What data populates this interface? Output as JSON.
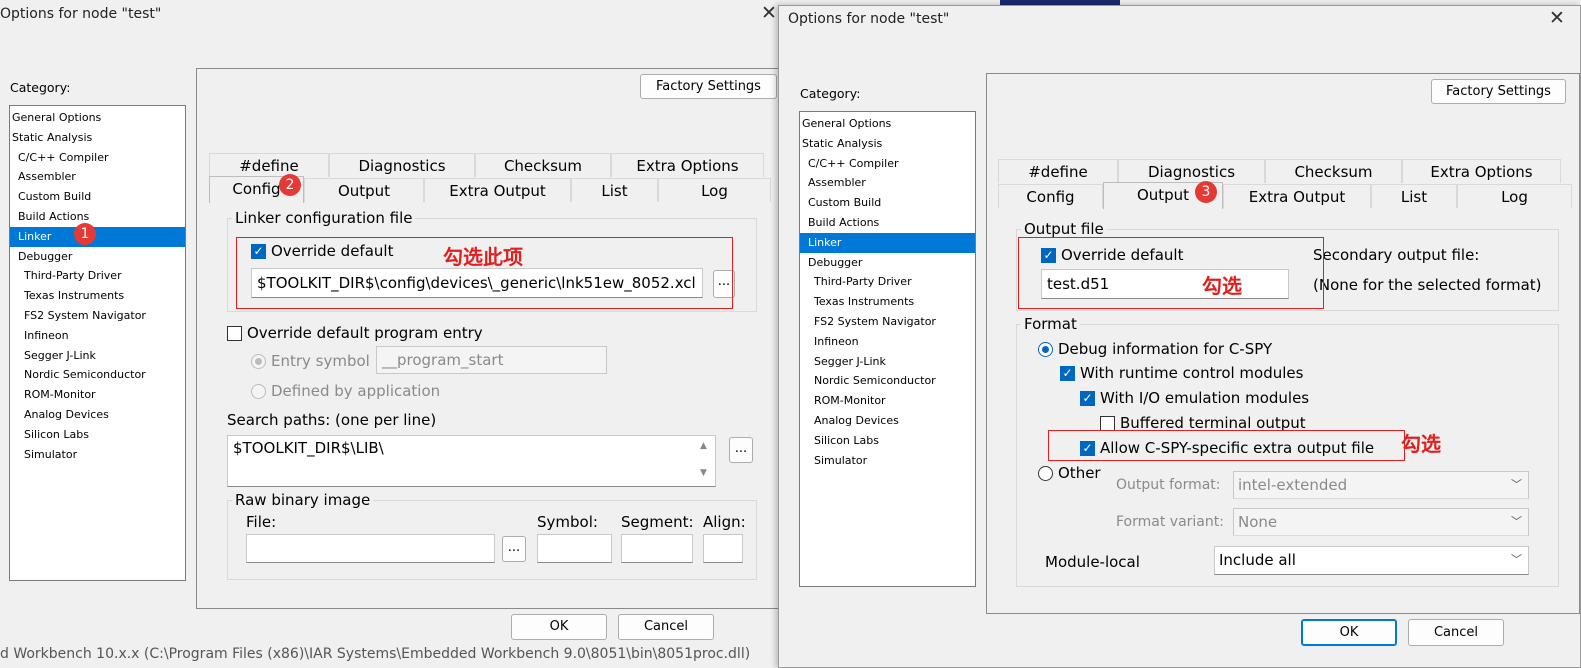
{
  "left": {
    "title": "Options for node \"test\"",
    "category_label": "Category:",
    "categories": [
      {
        "label": "General Options",
        "level": 0
      },
      {
        "label": "Static Analysis",
        "level": 0
      },
      {
        "label": "C/C++ Compiler",
        "level": 1
      },
      {
        "label": "Assembler",
        "level": 1
      },
      {
        "label": "Custom Build",
        "level": 1
      },
      {
        "label": "Build Actions",
        "level": 1
      },
      {
        "label": "Linker",
        "level": 1,
        "selected": true
      },
      {
        "label": "Debugger",
        "level": 1
      },
      {
        "label": "Third-Party Driver",
        "level": 2
      },
      {
        "label": "Texas Instruments",
        "level": 2
      },
      {
        "label": "FS2 System Navigator",
        "level": 2
      },
      {
        "label": "Infineon",
        "level": 2
      },
      {
        "label": "Segger J-Link",
        "level": 2
      },
      {
        "label": "Nordic Semiconductor",
        "level": 2
      },
      {
        "label": "ROM-Monitor",
        "level": 2
      },
      {
        "label": "Analog Devices",
        "level": 2
      },
      {
        "label": "Silicon Labs",
        "level": 2
      },
      {
        "label": "Simulator",
        "level": 2
      }
    ],
    "factory_settings": "Factory Settings",
    "tabs_row1": [
      "#define",
      "Diagnostics",
      "Checksum",
      "Extra Options"
    ],
    "tabs_row2": [
      "Config",
      "Output",
      "Extra Output",
      "List",
      "Log"
    ],
    "linker_group_title": "Linker configuration file",
    "override_default": "Override default",
    "config_path": "$TOOLKIT_DIR$\\config\\devices\\_generic\\lnk51ew_8052.xcl",
    "browse": "...",
    "override_entry": "Override default program entry",
    "entry_symbol": "Entry symbol",
    "entry_symbol_value": "__program_start",
    "defined_by_app": "Defined by application",
    "search_paths_label": "Search paths:  (one per line)",
    "search_paths_value": "$TOOLKIT_DIR$\\LIB\\",
    "raw_binary_title": "Raw binary image",
    "file_label": "File:",
    "symbol_label": "Symbol:",
    "segment_label": "Segment:",
    "align_label": "Align:",
    "ok": "OK",
    "cancel": "Cancel",
    "annotation": "勾选此项",
    "badge1": "1",
    "badge2": "2",
    "status_fragment": "d Workbench 10.x.x (C:\\Program Files (x86)\\IAR Systems\\Embedded Workbench 9.0\\8051\\bin\\8051proc.dll)"
  },
  "right": {
    "title": "Options for node \"test\"",
    "category_label": "Category:",
    "categories": [
      {
        "label": "General Options",
        "level": 0
      },
      {
        "label": "Static Analysis",
        "level": 0
      },
      {
        "label": "C/C++ Compiler",
        "level": 1
      },
      {
        "label": "Assembler",
        "level": 1
      },
      {
        "label": "Custom Build",
        "level": 1
      },
      {
        "label": "Build Actions",
        "level": 1
      },
      {
        "label": "Linker",
        "level": 1,
        "selected": true
      },
      {
        "label": "Debugger",
        "level": 1
      },
      {
        "label": "Third-Party Driver",
        "level": 2
      },
      {
        "label": "Texas Instruments",
        "level": 2
      },
      {
        "label": "FS2 System Navigator",
        "level": 2
      },
      {
        "label": "Infineon",
        "level": 2
      },
      {
        "label": "Segger J-Link",
        "level": 2
      },
      {
        "label": "Nordic Semiconductor",
        "level": 2
      },
      {
        "label": "ROM-Monitor",
        "level": 2
      },
      {
        "label": "Analog Devices",
        "level": 2
      },
      {
        "label": "Silicon Labs",
        "level": 2
      },
      {
        "label": "Simulator",
        "level": 2
      }
    ],
    "factory_settings": "Factory Settings",
    "tabs_row1": [
      "#define",
      "Diagnostics",
      "Checksum",
      "Extra Options"
    ],
    "tabs_row2": [
      "Config",
      "Output",
      "Extra Output",
      "List",
      "Log"
    ],
    "output_group_title": "Output file",
    "override_default": "Override default",
    "output_filename": "test.d51",
    "secondary_label": "Secondary output file:",
    "secondary_value": "(None for the selected format)",
    "format_group_title": "Format",
    "debug_info": "Debug information for C-SPY",
    "runtime_modules": "With runtime control modules",
    "io_emulation": "With I/O emulation modules",
    "buffered_output": "Buffered terminal output",
    "allow_extra": "Allow C-SPY-specific extra output file",
    "other": "Other",
    "output_format_label": "Output format:",
    "output_format_value": "intel-extended",
    "format_variant_label": "Format variant:",
    "format_variant_value": "None",
    "module_local_label": "Module-local",
    "module_local_value": "Include all",
    "ok": "OK",
    "cancel": "Cancel",
    "annotation_a": "勾选",
    "annotation_b": "勾选",
    "badge3": "3"
  }
}
